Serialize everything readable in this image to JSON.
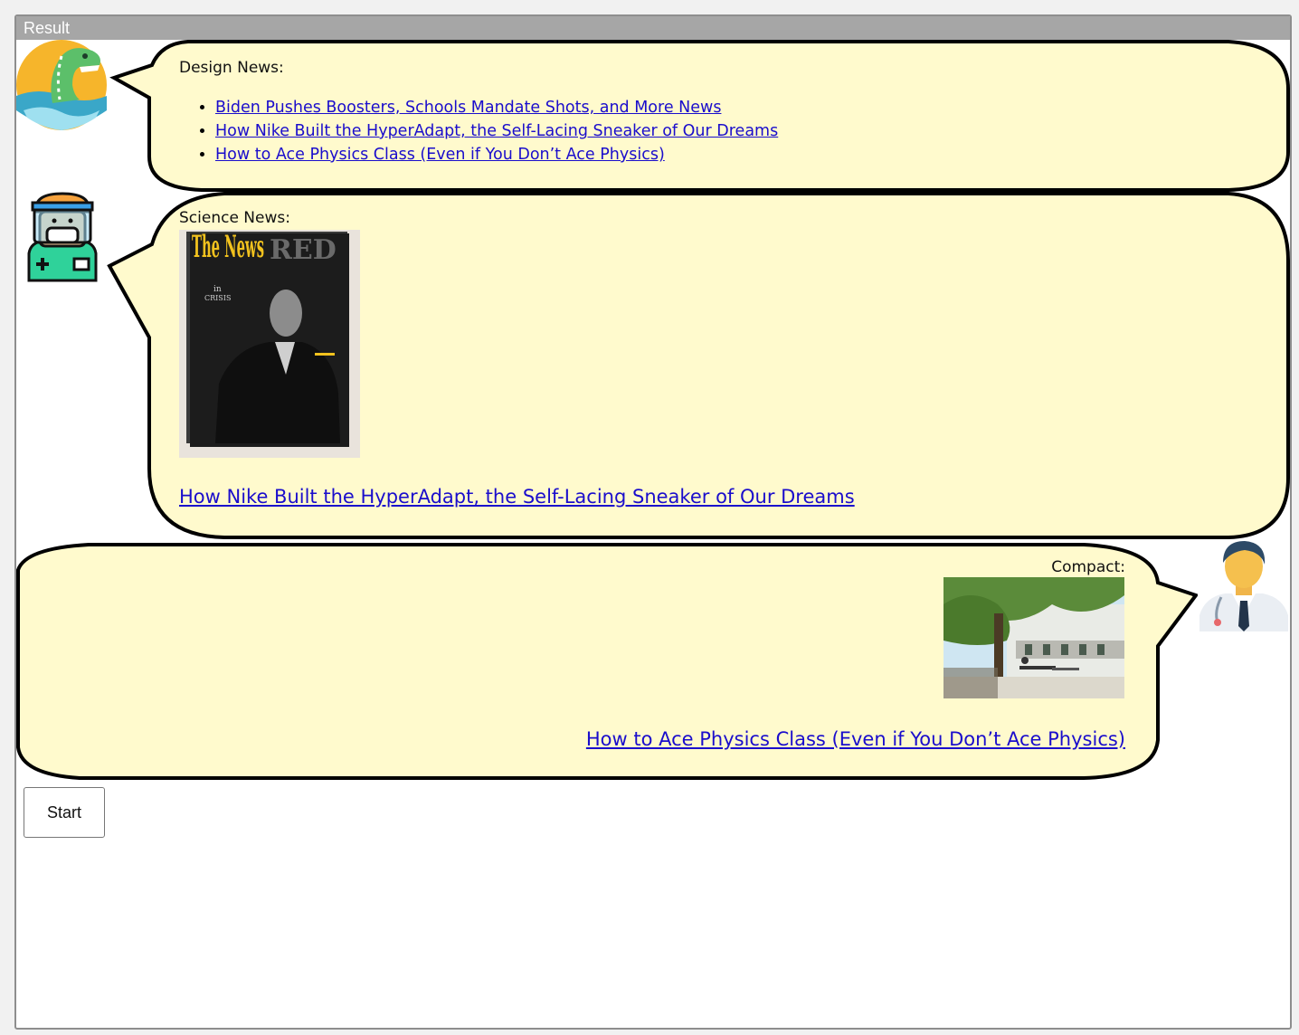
{
  "frame": {
    "title": "Result"
  },
  "messages": [
    {
      "avatar": "dinosaur-avatar",
      "title": "Design News:",
      "links": [
        "Biden Pushes Boosters, Schools Mandate Shots, and More News",
        "How Nike Built the HyperAdapt, the Self-Lacing Sneaker of Our Dreams",
        "How to Ace Physics Class (Even if You Don’t Ace Physics)"
      ]
    },
    {
      "avatar": "health-worker-avatar",
      "title": "Science News:",
      "image": {
        "magazine_title": "The News",
        "masthead": "RED",
        "tagline": "in",
        "subtitle": "CRISIS"
      },
      "link": "How Nike Built the HyperAdapt, the Self-Lacing Sneaker of Our Dreams"
    },
    {
      "avatar": "doctor-avatar",
      "title": "Compact:",
      "image": {
        "icon": "campus-photo"
      },
      "link": "How to Ace Physics Class (Even if You Don’t Ace Physics)"
    }
  ],
  "start_button": {
    "label": "Start"
  },
  "colors": {
    "bubble_fill": "#fffacd",
    "link": "#1a0dcc",
    "header": "#a6a6a6"
  }
}
